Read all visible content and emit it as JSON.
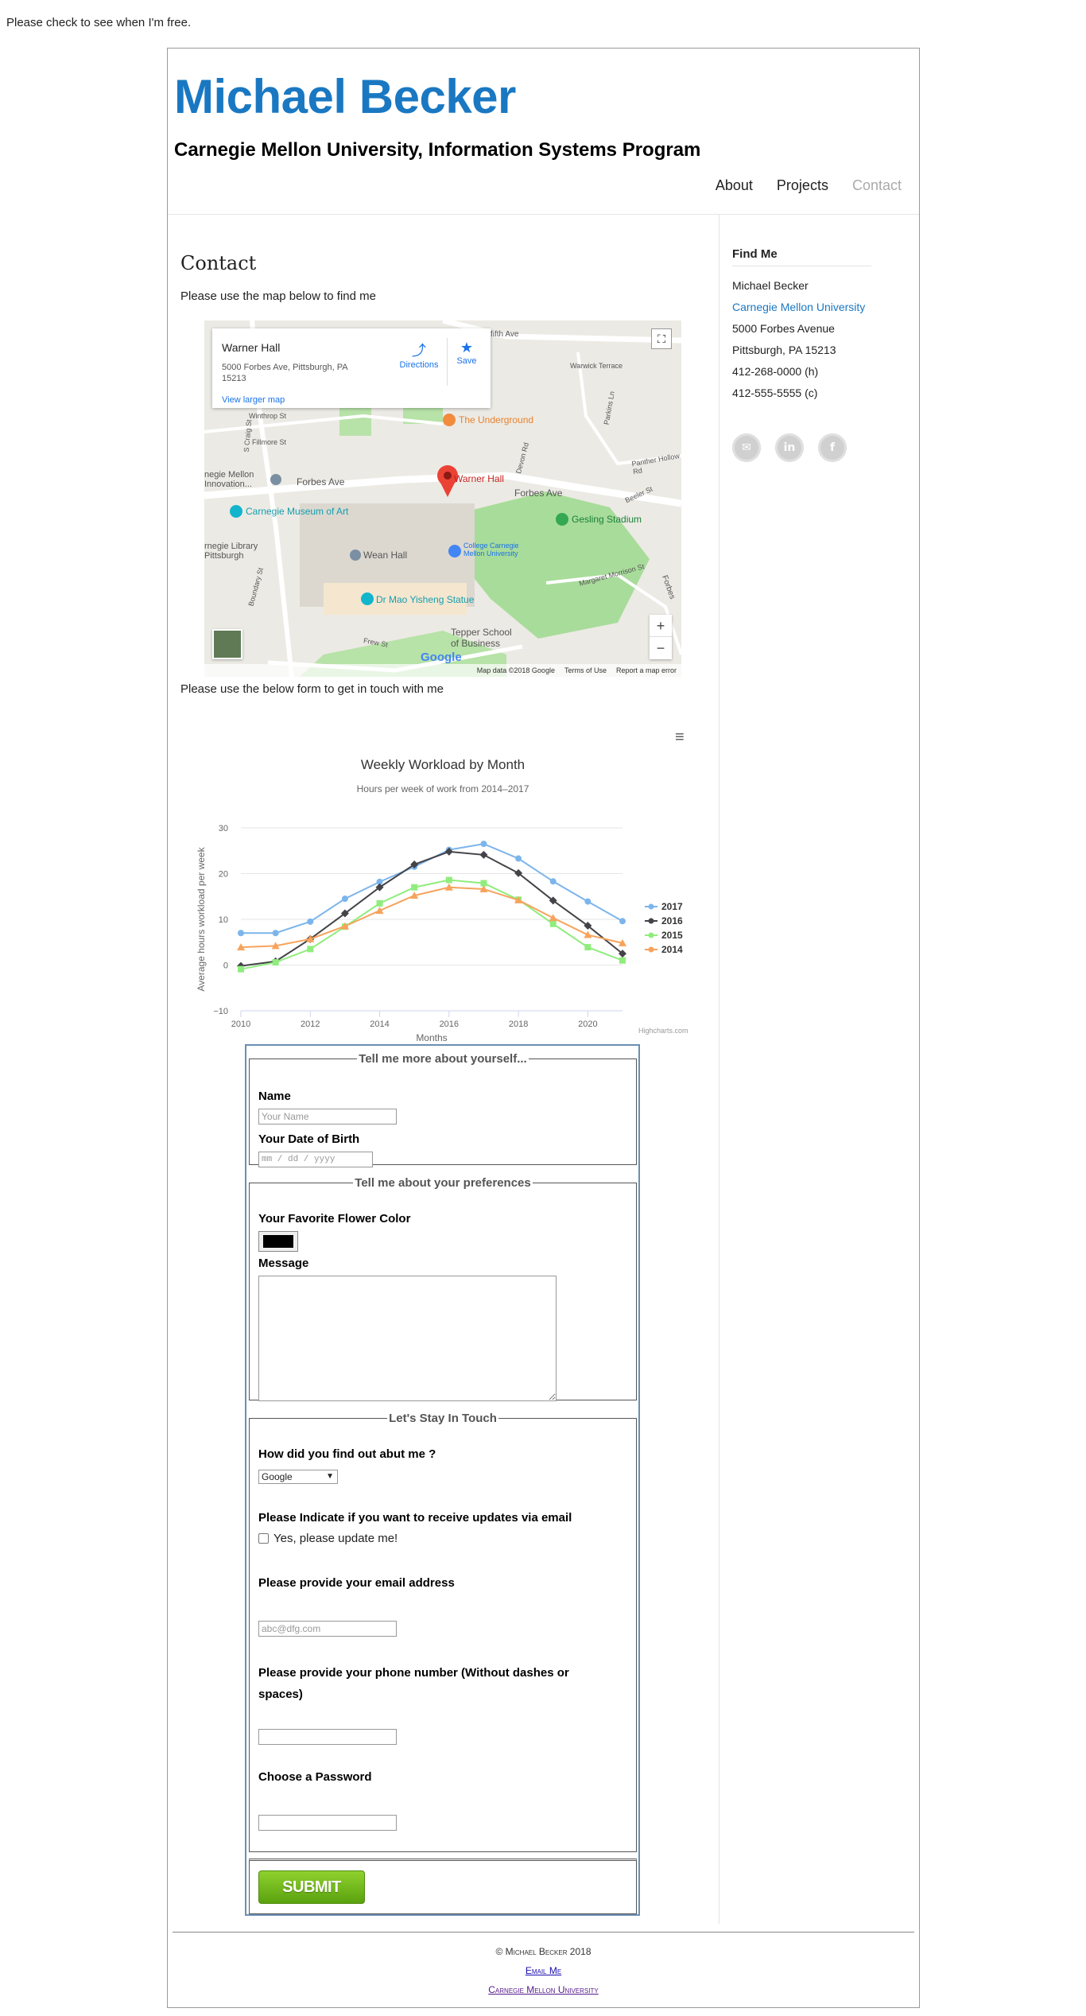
{
  "top_note": "Please check to see when I'm free.",
  "header": {
    "name": "Michael Becker",
    "subtitle": "Carnegie Mellon University, Information Systems Program",
    "nav": [
      "About",
      "Projects",
      "Contact"
    ]
  },
  "content": {
    "heading": "Contact",
    "map_note": "Please use the map below to find me",
    "form_note": "Please use the below form to get in touch with me"
  },
  "map": {
    "place": "Warner Hall",
    "address": "5000 Forbes Ave, Pittsburgh, PA 15213",
    "view_larger": "View larger map",
    "directions": "Directions",
    "save": "Save",
    "zoom_in": "+",
    "zoom_out": "−",
    "footer": [
      "Map data ©2018 Google",
      "Terms of Use",
      "Report a map error"
    ],
    "google": "Google",
    "labels": {
      "underground": "The Underground",
      "warner": "Warner Hall",
      "forbes1": "Forbes Ave",
      "forbes2": "Forbes Ave",
      "museum": "Carnegie Museum of Art",
      "gesling": "Gesling Stadium",
      "mellon": "negie Mellon Innovation...",
      "library": "rnegie Library Pittsburgh",
      "wean": "Wean Hall",
      "college": "College Carnegie Mellon University",
      "statue": "Dr Mao Yisheng Statue",
      "tepper": "Tepper School of Business",
      "fifth": "fifth Ave",
      "warwick": "Warwick Terrace",
      "winthrop": "Winthrop St",
      "fillmore": "Fillmore St",
      "craig": "S Craig St",
      "boundary": "Boundary St",
      "frew": "Frew St",
      "margaret": "Margaret Morrison St",
      "forbes_s": "Forbes",
      "devon": "Devon Rd",
      "panther": "Panther Hollow Rd",
      "beeler": "Beeler St",
      "parkins": "Parkins Ln"
    }
  },
  "chart_data": {
    "type": "line",
    "title": "Weekly Workload by Month",
    "subtitle": "Hours per week of work from 2014–2017",
    "xlabel": "Months",
    "ylabel": "Average hours workload per week",
    "x": [
      2010,
      2011,
      2012,
      2013,
      2014,
      2015,
      2016,
      2017,
      2018,
      2019,
      2020,
      2021
    ],
    "xlim": [
      2010,
      2021
    ],
    "ylim": [
      -10,
      30
    ],
    "xticks": [
      "2010",
      "2012",
      "2014",
      "2016",
      "2018",
      "2020"
    ],
    "yticks": [
      "30",
      "20",
      "10",
      "0",
      "−10"
    ],
    "grid": true,
    "legend": "right",
    "credits": "Highcharts.com",
    "series": [
      {
        "name": "2017",
        "color": "#7cb5ec",
        "marker": "circle",
        "values": [
          7.0,
          7.0,
          9.5,
          14.5,
          18.2,
          21.5,
          25.2,
          26.5,
          23.3,
          18.3,
          13.9,
          9.6
        ]
      },
      {
        "name": "2016",
        "color": "#434348",
        "marker": "diamond",
        "values": [
          -0.2,
          0.8,
          5.7,
          11.3,
          17.0,
          22.0,
          24.8,
          24.1,
          20.1,
          14.1,
          8.6,
          2.5
        ]
      },
      {
        "name": "2015",
        "color": "#90ed7d",
        "marker": "square",
        "values": [
          -0.9,
          0.6,
          3.5,
          8.4,
          13.5,
          17.0,
          18.6,
          17.9,
          14.3,
          9.0,
          3.9,
          1.0
        ]
      },
      {
        "name": "2014",
        "color": "#f7a35c",
        "marker": "triangle",
        "values": [
          3.9,
          4.2,
          5.7,
          8.5,
          11.9,
          15.2,
          17.0,
          16.6,
          14.2,
          10.3,
          6.6,
          4.8
        ]
      }
    ]
  },
  "form": {
    "fieldset1": {
      "legend": "Tell me more about yourself...",
      "name_label": "Name",
      "name_placeholder": "Your Name",
      "dob_label": "Your Date of Birth",
      "dob_placeholder": "mm / dd / yyyy"
    },
    "fieldset2": {
      "legend": "Tell me about your preferences",
      "color_label": "Your Favorite Flower Color",
      "color_value": "#000000",
      "message_label": "Message"
    },
    "fieldset3": {
      "legend": "Let's Stay In Touch",
      "found_label": "How did you find out abut me ?",
      "found_value": "Google",
      "updates_label": "Please Indicate if you want to receive updates via email",
      "updates_check": "Yes, please update me!",
      "email_label": "Please provide your email address",
      "email_placeholder": "abc@dfg.com",
      "phone_label": "Please provide your phone number (Without dashes or spaces)",
      "password_label": "Choose a Password"
    },
    "submit": "SUBMIT"
  },
  "aside": {
    "heading": "Find Me",
    "name": "Michael Becker",
    "university": "Carnegie Mellon University",
    "street": "5000 Forbes Avenue",
    "city": "Pittsburgh, PA 15213",
    "phone_h": "412-268-0000 (h)",
    "phone_c": "412-555-5555 (c)",
    "socials": [
      "email-icon",
      "linkedin-icon",
      "facebook-icon"
    ]
  },
  "footer": {
    "copyright": "© Michael Becker 2018",
    "email_link": "Email Me",
    "university_link": "Carnegie Mellon University"
  }
}
